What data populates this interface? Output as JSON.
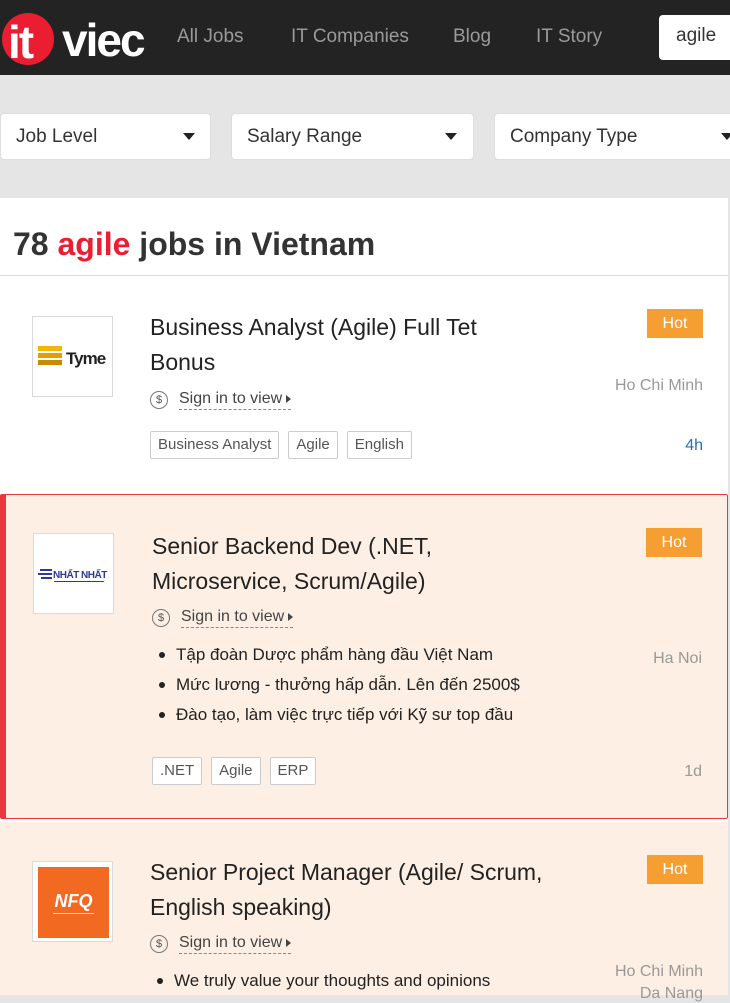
{
  "header": {
    "logo_it": "it",
    "logo_viec": "viec",
    "nav": [
      "All Jobs",
      "IT Companies",
      "Blog",
      "IT Story"
    ],
    "search_value": "agile"
  },
  "filters": [
    "Job Level",
    "Salary Range",
    "Company Type"
  ],
  "results": {
    "count": "78",
    "keyword": "agile",
    "suffix": "jobs in Vietnam"
  },
  "jobs": [
    {
      "title": "Business Analyst (Agile) Full Tet Bonus",
      "company_logo_text": "Tyme",
      "salary": "Sign in to view",
      "badge": "Hot",
      "city": "Ho Chi Minh",
      "time": "4h",
      "tags": [
        "Business Analyst",
        "Agile",
        "English"
      ]
    },
    {
      "title": "Senior Backend Dev (.NET, Microservice, Scrum/Agile)",
      "company_logo_text": "NHẤT NHẤT",
      "salary": "Sign in to view",
      "badge": "Hot",
      "city": "Ha Noi",
      "time": "1d",
      "bullets": [
        "Tập đoàn Dược phẩm hàng đầu Việt Nam",
        "Mức lương - thưởng hấp dẫn. Lên đến 2500$",
        "Đào tạo, làm việc trực tiếp với Kỹ sư top đầu"
      ],
      "tags": [
        ".NET",
        "Agile",
        "ERP"
      ]
    },
    {
      "title": "Senior Project Manager (Agile/ Scrum, English speaking)",
      "company_logo_text": "NFQ",
      "salary": "Sign in to view",
      "badge": "Hot",
      "city": "Ho Chi Minh",
      "city2": "Da Nang",
      "bullets": [
        "We truly value your thoughts and opinions"
      ]
    }
  ],
  "colors": {
    "brand_red": "#ea1e30",
    "hot_orange": "#f59f33",
    "highlight_bg": "#fdefe3",
    "time_blue": "#2a6db5"
  }
}
